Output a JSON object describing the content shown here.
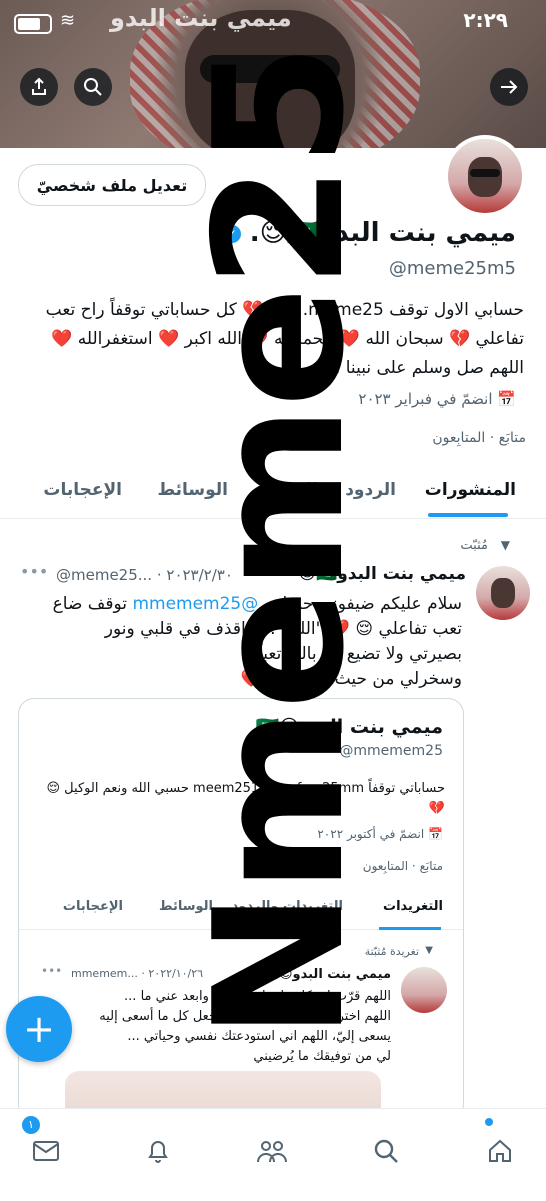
{
  "status_bar": {
    "time": "٢:٢٩",
    "title_overlay": "ميمي بنت البدو"
  },
  "profile": {
    "display_name": "ميمي بنت البدو🇸🇦😌.",
    "handle": "@meme25m5",
    "edit_button": "تعديل ملف شخصيّ",
    "bio_line1": "حسابي الاول توقف meme25... 😌 💔 كل حساباتي توقفاً راح تعب",
    "bio_line2": "تفاعلي 💔 سبحان الله ❤️ الحمدلله 💔 الله اكبر ❤️ استغفرالله ❤️",
    "bio_line3": "اللهم صل وسلم على نبينا ...",
    "joined": "انضمّ في فبراير ٢٠٢٣",
    "following_label": "متابَع",
    "followers_label": "المتابِعون"
  },
  "tabs": [
    "المنشورات",
    "الردود",
    "المميزة",
    "الوسائط",
    "الإعجابات"
  ],
  "pinned_tweet": {
    "pinned_label": "مُثبّت",
    "author": "ميمي بنت البدو🇸🇦😌",
    "handle_date": "@meme25... · ٢٠٢٣/٢/٣٠",
    "line1": "سلام عليكم ضيفوني حسابي",
    "mention": "@mmemem25",
    "line1_end": "توقف ضاع",
    "line2": "تعب تفاعلي 😌 💔 \"اللهم ... واقذف في قلبي ونور",
    "line3": "بصيرتي ولا تضيع لي بالله تعباً",
    "line4": "وسخرلي من حيث لا احتسب❤️"
  },
  "quoted_card": {
    "name": "ميمي بنت البدو😌🇸🇦",
    "handle": "@mmemem25",
    "bio": "حساباتي توقفاً meem2517 mmfme25mm حسبي الله ونعم الوكيل 😌 💔",
    "joined": "انضمّ في أكتوبر ٢٠٢٢",
    "following_label": "متابَع",
    "followers_label": "المتابِعون",
    "tabs": [
      "التغريدات",
      "التغريدات والردود",
      "الوسائط",
      "الإعجابات"
    ],
    "pinned_label": "تغريدة مُثبّتة",
    "tweet_author": "ميمي بنت البدو😌🇸🇦",
    "tweet_date": "mmemem... · ٢٠٢٢/١٠/٢٦",
    "tweet_line1": "اللهم قرّب لي كل ما تراه خير لي وابعد عني ما ...",
    "tweet_line2": "اللهم اختر لي ولا تُخيرني، يارب أجعل كل ما أسعى إليه",
    "tweet_line3": "يسعى إليّ، اللهم اني استودعتك نفسي وحياتي ...",
    "tweet_line4": "لي من توفيقك ما يُرضيني"
  },
  "watermark": "Nmeme25",
  "nav": {
    "messages_badge": "١"
  },
  "icons": {
    "share": "share-icon",
    "search": "search-icon",
    "back": "arrow-right-icon",
    "compose": "plus-icon"
  },
  "colors": {
    "accent": "#1d9bf0",
    "text": "#0f1419",
    "muted": "#536471"
  }
}
